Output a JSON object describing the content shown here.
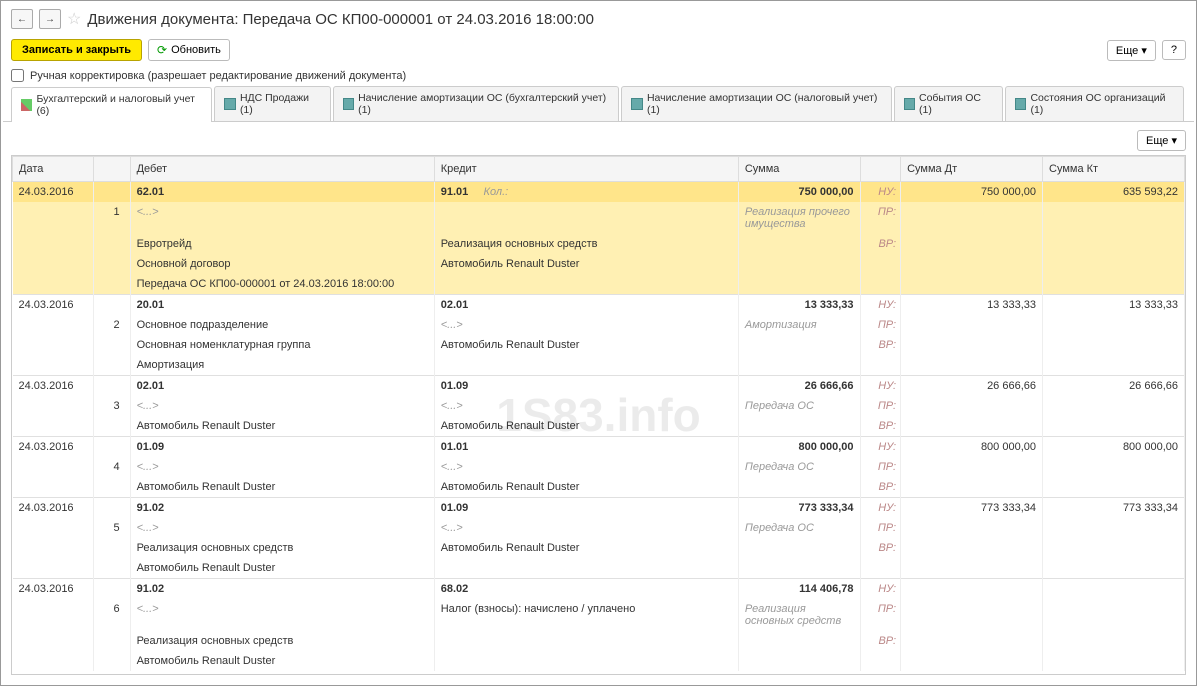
{
  "title": "Движения документа: Передача ОС КП00-000001 от 24.03.2016 18:00:00",
  "toolbar": {
    "save_close": "Записать и закрыть",
    "refresh": "Обновить",
    "more": "Еще",
    "help": "?"
  },
  "manual_corr": "Ручная корректировка (разрешает редактирование движений документа)",
  "tabs": [
    "Бухгалтерский и налоговый учет (6)",
    "НДС Продажи (1)",
    "Начисление амортизации ОС (бухгалтерский учет) (1)",
    "Начисление амортизации ОС (налоговый учет) (1)",
    "События ОС (1)",
    "Состояния ОС организаций (1)"
  ],
  "sub_more": "Еще",
  "headers": {
    "date": "Дата",
    "debit": "Дебет",
    "credit": "Кредит",
    "sum": "Сумма",
    "sum_dt": "Сумма Дт",
    "sum_kt": "Сумма Кт"
  },
  "tax_labels": {
    "nu": "НУ:",
    "pr": "ПР:",
    "vr": "ВР:"
  },
  "kol": "Кол.:",
  "watermark": "1S83.info",
  "rows": [
    {
      "date": "24.03.2016",
      "idx": "1",
      "highlight": true,
      "debit_acc": "62.01",
      "credit_acc": "91.01",
      "sum": "750 000,00",
      "sum_dt": "750 000,00",
      "sum_kt": "635 593,22",
      "sum_desc": "Реализация прочего имущества",
      "debit_lines": [
        "<...>",
        "Евротрейд",
        "Основной договор",
        "Передача ОС КП00-000001 от 24.03.2016 18:00:00"
      ],
      "credit_lines": [
        "",
        "Реализация основных средств",
        "Автомобиль Renault Duster"
      ]
    },
    {
      "date": "24.03.2016",
      "idx": "2",
      "debit_acc": "20.01",
      "credit_acc": "02.01",
      "sum": "13 333,33",
      "sum_dt": "13 333,33",
      "sum_kt": "13 333,33",
      "sum_desc": "Амортизация",
      "debit_lines": [
        "Основное подразделение",
        "Основная номенклатурная группа",
        "Амортизация"
      ],
      "credit_lines": [
        "<...>",
        "Автомобиль Renault Duster"
      ]
    },
    {
      "date": "24.03.2016",
      "idx": "3",
      "debit_acc": "02.01",
      "credit_acc": "01.09",
      "sum": "26 666,66",
      "sum_dt": "26 666,66",
      "sum_kt": "26 666,66",
      "sum_desc": "Передача ОС",
      "debit_lines": [
        "<...>",
        "Автомобиль Renault Duster"
      ],
      "credit_lines": [
        "<...>",
        "Автомобиль Renault Duster"
      ]
    },
    {
      "date": "24.03.2016",
      "idx": "4",
      "debit_acc": "01.09",
      "credit_acc": "01.01",
      "sum": "800 000,00",
      "sum_dt": "800 000,00",
      "sum_kt": "800 000,00",
      "sum_desc": "Передача ОС",
      "debit_lines": [
        "<...>",
        "Автомобиль Renault Duster"
      ],
      "credit_lines": [
        "<...>",
        "Автомобиль Renault Duster"
      ]
    },
    {
      "date": "24.03.2016",
      "idx": "5",
      "debit_acc": "91.02",
      "credit_acc": "01.09",
      "sum": "773 333,34",
      "sum_dt": "773 333,34",
      "sum_kt": "773 333,34",
      "sum_desc": "Передача ОС",
      "debit_lines": [
        "<...>",
        "Реализация основных средств",
        "Автомобиль Renault Duster"
      ],
      "credit_lines": [
        "<...>",
        "Автомобиль Renault Duster"
      ]
    },
    {
      "date": "24.03.2016",
      "idx": "6",
      "debit_acc": "91.02",
      "credit_acc": "68.02",
      "sum": "114 406,78",
      "sum_dt": "",
      "sum_kt": "",
      "sum_desc": "Реализация основных средств",
      "debit_lines": [
        "<...>",
        "Реализация основных средств",
        "Автомобиль Renault Duster"
      ],
      "credit_lines": [
        "Налог (взносы): начислено / уплачено"
      ]
    }
  ]
}
